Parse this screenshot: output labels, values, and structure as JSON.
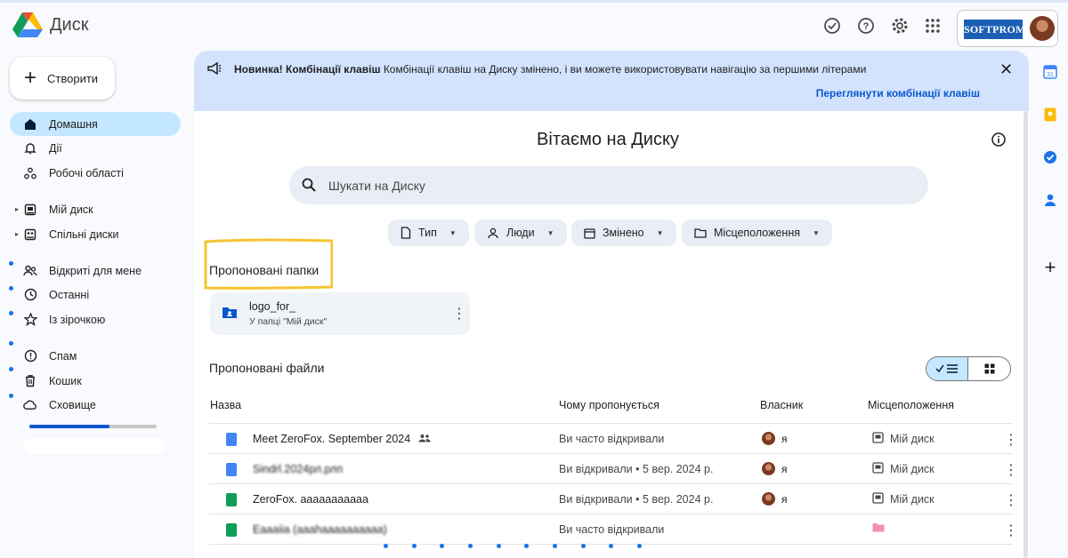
{
  "app": {
    "title": "Диск"
  },
  "header": {
    "account_brand": "SOFTPROM"
  },
  "sidebar": {
    "create_label": "Створити",
    "items": [
      {
        "label": "Домашня"
      },
      {
        "label": "Дії"
      },
      {
        "label": "Робочі області"
      },
      {
        "label": "Мій диск"
      },
      {
        "label": "Спільні диски"
      },
      {
        "label": "Відкриті для мене"
      },
      {
        "label": "Останні"
      },
      {
        "label": "Із зірочкою"
      },
      {
        "label": "Спам"
      },
      {
        "label": "Кошик"
      },
      {
        "label": "Сховище"
      }
    ],
    "storage_used_fraction": 0.63
  },
  "banner": {
    "bold": "Новинка! Комбінації клавіш",
    "text": " Комбінації клавіш на Диску змінено, і ви можете використовувати навігацію за першими літерами",
    "link": "Переглянути комбінації клавіш"
  },
  "main": {
    "welcome": "Вітаємо на Диску",
    "search_placeholder": "Шукати на Диску",
    "chips": [
      "Тип",
      "Люди",
      "Змінено",
      "Місцеположення"
    ],
    "suggested_folders_title": "Пропоновані папки",
    "folder": {
      "name": "logo_for_",
      "location": "У папці \"Мій диск\""
    },
    "suggested_files_title": "Пропоновані файли",
    "columns": [
      "Назва",
      "Чому пропонується",
      "Власник",
      "Місцеположення"
    ],
    "files": [
      {
        "name": "Meet ZeroFox. September 2024",
        "reason": "Ви часто відкривали",
        "owner": "я",
        "location": "Мій диск",
        "type": "doc",
        "shared": true
      },
      {
        "name": "Sindrl.2024рл.рлп",
        "reason": "Ви відкривали • 5 вер. 2024 р.",
        "owner": "я",
        "location": "Мій диск",
        "type": "doc"
      },
      {
        "name": "ZeroFox. ааааааааааа",
        "reason": "Ви відкривали • 5 вер. 2024 р.",
        "owner": "я",
        "location": "Мій диск",
        "type": "sheet"
      },
      {
        "name": "Eaaaiia (aaahaaaaaaaaaa)",
        "reason": "Ви часто відкривали",
        "owner": "",
        "location": "",
        "type": "sheet"
      }
    ]
  },
  "colors": {
    "accent": "#0b57d0",
    "active_nav": "#c2e7ff",
    "banner_bg": "#d3e3fd",
    "highlight": "#f4c430",
    "doc_blue": "#4285f4",
    "sheet_green": "#0f9d58"
  }
}
